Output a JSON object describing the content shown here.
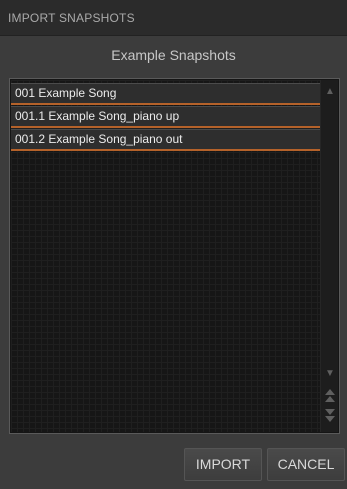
{
  "dialog": {
    "title": "IMPORT SNAPSHOTS",
    "subtitle": "Example Snapshots"
  },
  "list": {
    "items": [
      {
        "label": "001 Example Song"
      },
      {
        "label": "001.1 Example Song_piano up"
      },
      {
        "label": "001.2 Example Song_piano out"
      }
    ],
    "accent_color": "#b5622a"
  },
  "scrollbar": {
    "up_icon": "triangle-up-icon",
    "down_icon": "triangle-down-icon",
    "top_icon": "double-triangle-up-icon",
    "bottom_icon": "double-triangle-down-icon"
  },
  "buttons": {
    "import_label": "IMPORT",
    "cancel_label": "CANCEL"
  }
}
